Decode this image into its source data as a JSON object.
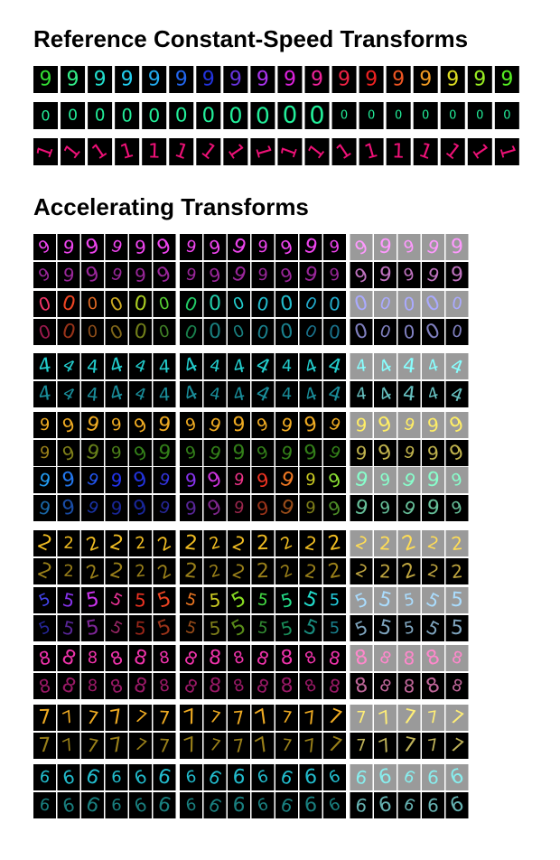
{
  "titles": {
    "reference": "Reference Constant-Speed Transforms",
    "accelerating": "Accelerating Transforms"
  },
  "reference_rows": [
    {
      "digit": "9",
      "transform": "color",
      "colors": [
        "#33dd33",
        "#33ee88",
        "#22ddcc",
        "#22ccee",
        "#22aaee",
        "#2266ee",
        "#2233dd",
        "#6633dd",
        "#aa33ee",
        "#dd22dd",
        "#ee2299",
        "#ee2244",
        "#ee2222",
        "#ee5522",
        "#ee9922",
        "#dddd22",
        "#99ee22",
        "#55ee22"
      ]
    },
    {
      "digit": "0",
      "transform": "scale",
      "colors": [
        "#22ee99"
      ]
    },
    {
      "digit": "1",
      "transform": "rotate",
      "colors": [
        "#ee1177"
      ]
    }
  ],
  "accel_groups": [
    {
      "digit": "9",
      "colors_top": [
        "#ee44ee"
      ],
      "colors_bottom": [
        "#cc33cc"
      ],
      "test_tint": "#ff99ff"
    },
    {
      "digit": "0",
      "colors_top": [
        "#ee3366",
        "#ee4422",
        "#dd6622",
        "#ccaa22",
        "#aacc22",
        "#55cc33",
        "#22cc66",
        "#22ccaa",
        "#22cccc",
        "#22bbcc",
        "#22bbcc",
        "#22aacc",
        "#22aacc"
      ],
      "colors_bottom": [
        "#cc2266",
        "#cc4422",
        "#bb6622",
        "#aa8822",
        "#99aa22",
        "#55aa33",
        "#22aa66",
        "#22aaaa",
        "#22aaaa",
        "#22aabb",
        "#22aabb",
        "#2299bb",
        "#2299bb"
      ],
      "test_tint": "#aaaaff"
    },
    {
      "digit": "4",
      "colors_top": [
        "#22cccc"
      ],
      "colors_bottom": [
        "#22bbcc"
      ],
      "test_tint": "#88ffff"
    },
    {
      "digit": "9",
      "colors_top": [
        "#eeaa22"
      ],
      "colors_bottom": [
        "#ccaa22",
        "#aaaa22",
        "#88aa22",
        "#66aa22",
        "#44aa22"
      ],
      "test_tint": "#ffee66"
    },
    {
      "digit": "9",
      "colors_top": [
        "#2299ee",
        "#2277ee",
        "#2255ee",
        "#2233ee",
        "#2233dd",
        "#3333dd",
        "#8833ee",
        "#cc33dd",
        "#ee3388",
        "#ee3322",
        "#ee7722",
        "#cccc22",
        "#88dd33"
      ],
      "colors_bottom": [
        "#2288dd",
        "#2266dd",
        "#2244dd",
        "#2233cc",
        "#2233cc",
        "#3333cc",
        "#7733cc",
        "#aa33bb",
        "#cc3366",
        "#cc4422",
        "#cc6622",
        "#aaaa22",
        "#66bb33"
      ],
      "test_tint": "#88ffcc"
    },
    {
      "digit": "2",
      "colors_top": [
        "#eebb22"
      ],
      "colors_bottom": [
        "#ccaa22"
      ],
      "test_tint": "#ffdd55"
    },
    {
      "digit": "5",
      "colors_top": [
        "#4444ee",
        "#8833ee",
        "#cc33ee",
        "#ee3399",
        "#ee3322",
        "#ee4422",
        "#ee7722",
        "#cccc22",
        "#88dd22",
        "#44dd44",
        "#22dd88",
        "#22ddcc",
        "#22ccdd"
      ],
      "colors_bottom": [
        "#3333cc",
        "#7733cc",
        "#aa33cc",
        "#cc3388",
        "#cc3322",
        "#cc4422",
        "#cc6622",
        "#aaaa22",
        "#77bb22",
        "#44bb44",
        "#22bb77",
        "#22bbaa",
        "#22aabb"
      ],
      "test_tint": "#aaddff"
    },
    {
      "digit": "8",
      "colors_top": [
        "#ee33aa"
      ],
      "colors_bottom": [
        "#cc2288"
      ],
      "test_tint": "#ff88cc"
    },
    {
      "digit": "7",
      "colors_top": [
        "#eeaa22"
      ],
      "colors_bottom": [
        "#ccaa22"
      ],
      "test_tint": "#ffee77"
    },
    {
      "digit": "6",
      "colors_top": [
        "#22bbcc"
      ],
      "colors_bottom": [
        "#22aaaa"
      ],
      "test_tint": "#88eeee"
    }
  ]
}
